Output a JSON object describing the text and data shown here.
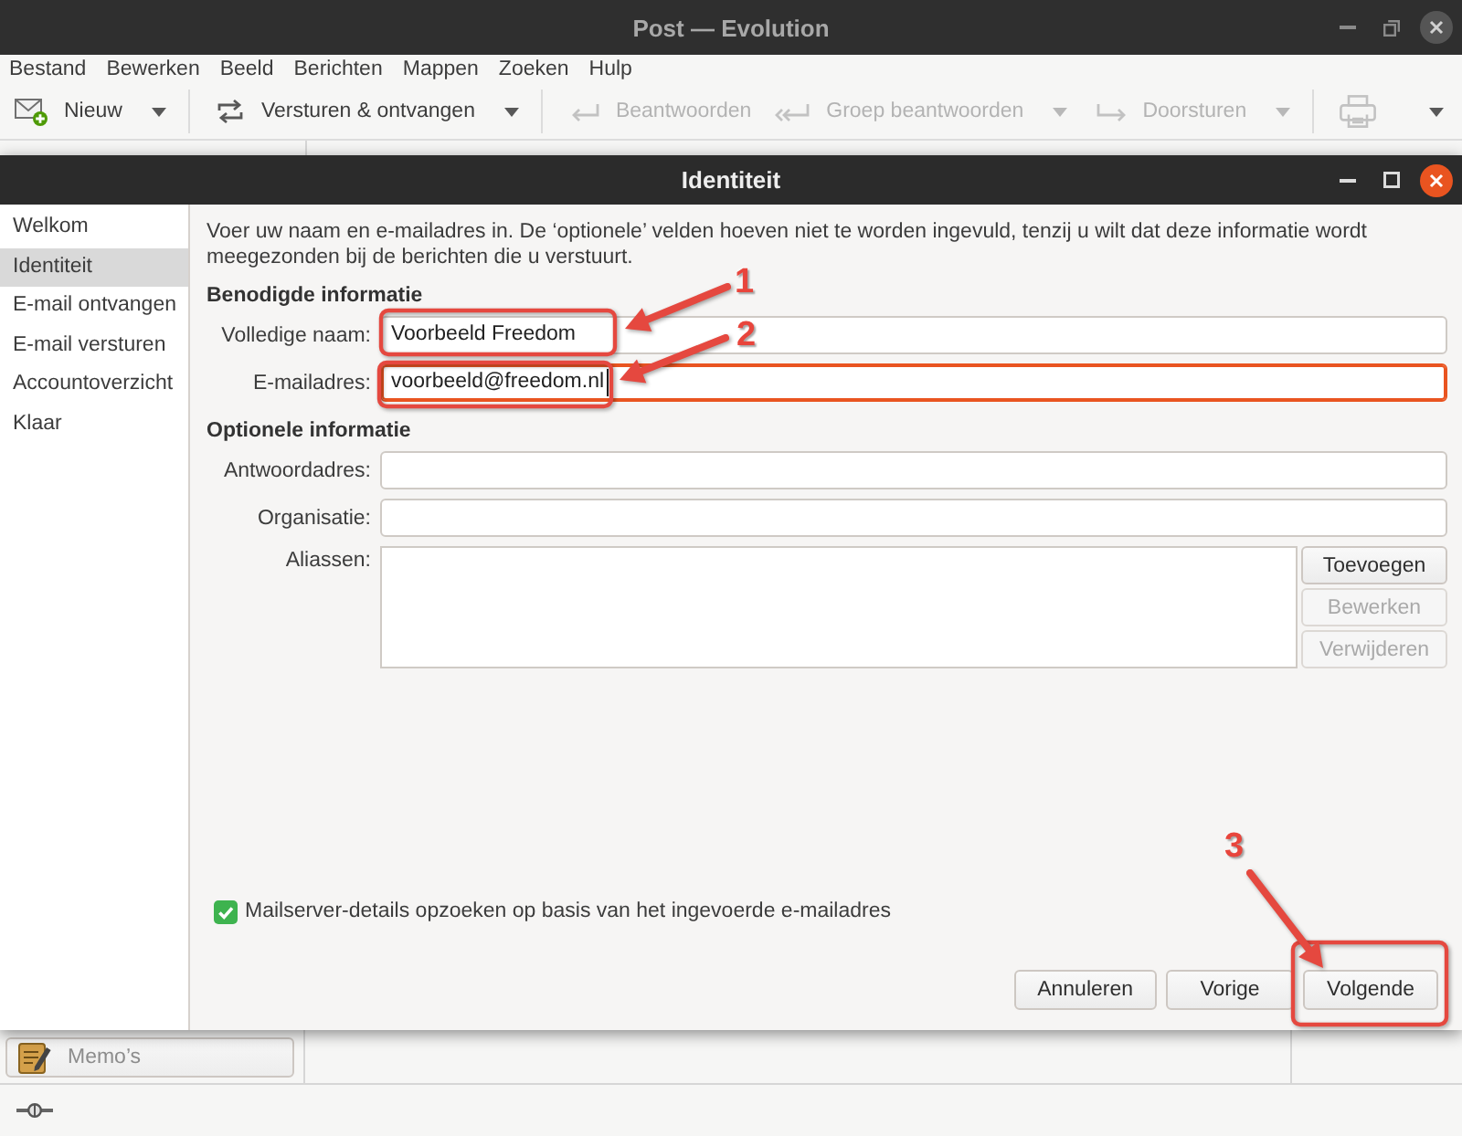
{
  "app_window": {
    "title": "Post — Evolution"
  },
  "menu_bar": [
    "Bestand",
    "Bewerken",
    "Beeld",
    "Berichten",
    "Mappen",
    "Zoeken",
    "Hulp"
  ],
  "toolbar": {
    "groups": [
      {
        "items": [
          {
            "kind": "new",
            "label": "Nieuw",
            "disabled": false,
            "menu": true
          }
        ]
      },
      {
        "items": [
          {
            "kind": "sync",
            "label": "Versturen & ontvangen",
            "disabled": false,
            "menu": true
          }
        ]
      },
      {
        "items": [
          {
            "kind": "reply",
            "label": "Beantwoorden",
            "disabled": true,
            "menu": false
          },
          {
            "kind": "reply_all",
            "label": "Groep beantwoorden",
            "disabled": true,
            "menu": true
          },
          {
            "kind": "forward",
            "label": "Doorsturen",
            "disabled": true,
            "menu": true
          }
        ]
      },
      {
        "items": [
          {
            "kind": "print",
            "disabled": true,
            "menu": false
          },
          {
            "kind": "overflow",
            "disabled": false,
            "menu": false
          }
        ]
      }
    ]
  },
  "dialog": {
    "title": "Identiteit",
    "steps": [
      {
        "label": "Welkom",
        "selected": false
      },
      {
        "label": "Identiteit",
        "selected": true
      },
      {
        "label": "E-mail ontvangen",
        "selected": false
      },
      {
        "label": "E-mail versturen",
        "selected": false
      },
      {
        "label": "Accountoverzicht",
        "selected": false
      },
      {
        "label": "Klaar",
        "selected": false
      }
    ],
    "intro": "Voer uw naam en e-mailadres in. De ‘optionele’ velden hoeven niet te worden ingevuld, tenzij u wilt dat deze informatie wordt meegezonden bij de berichten die u verstuurt.",
    "sections": [
      {
        "heading": "Benodigde informatie",
        "fields": [
          {
            "kind": "entry",
            "label": "Volledige naam:",
            "value": "Voorbeeld Freedom",
            "focused": false
          },
          {
            "kind": "entry",
            "label": "E-mailadres:",
            "value": "voorbeeld@freedom.nl",
            "focused": true
          }
        ]
      },
      {
        "heading": "Optionele informatie",
        "fields": [
          {
            "kind": "entry",
            "label": "Antwoordadres:",
            "focused": false
          },
          {
            "kind": "entry",
            "label": "Organisatie:",
            "focused": false
          },
          {
            "kind": "list",
            "label": "Aliassen:",
            "buttons": [
              {
                "label": "Toevoegen",
                "disabled": false
              },
              {
                "label": "Bewerken",
                "disabled": true
              },
              {
                "label": "Verwijderen",
                "disabled": true
              }
            ]
          }
        ]
      }
    ],
    "lookup_option": {
      "label": "Mailserver-details opzoeken op basis van het ingevoerde e-mailadres",
      "checked": true
    },
    "buttons": [
      {
        "label": "Annuleren"
      },
      {
        "label": "Vorige"
      },
      {
        "label": "Volgende"
      }
    ]
  },
  "component_switcher": {
    "label": "Memo’s"
  },
  "callouts": [
    {
      "number": "1"
    },
    {
      "number": "2"
    },
    {
      "number": "3"
    }
  ]
}
